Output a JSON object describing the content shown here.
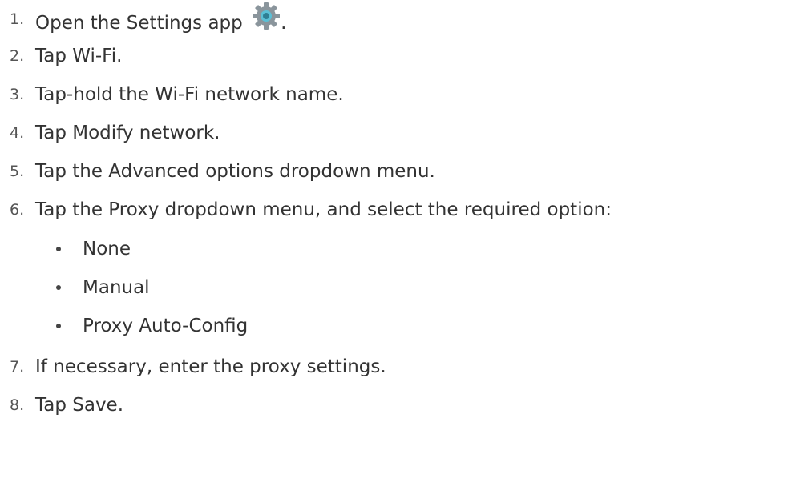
{
  "steps": [
    {
      "number": "1.",
      "text": "Open the Settings app",
      "suffix": ".",
      "icon": "settings-gear-icon"
    },
    {
      "number": "2.",
      "text": "Tap Wi-Fi."
    },
    {
      "number": "3.",
      "text": "Tap-hold the Wi-Fi network name."
    },
    {
      "number": "4.",
      "text": "Tap Modify network."
    },
    {
      "number": "5.",
      "text": "Tap the Advanced options dropdown menu."
    },
    {
      "number": "6.",
      "text": "Tap the Proxy dropdown menu, and select the required option:"
    },
    {
      "number": "7.",
      "text": "If necessary, enter the proxy settings."
    },
    {
      "number": "8.",
      "text": "Tap Save."
    }
  ],
  "proxy_options": [
    "None",
    "Manual",
    "Proxy Auto-Config"
  ],
  "colors": {
    "text": "#333333",
    "gear": "#8a959c",
    "gear_center": "#5bc0d6"
  }
}
